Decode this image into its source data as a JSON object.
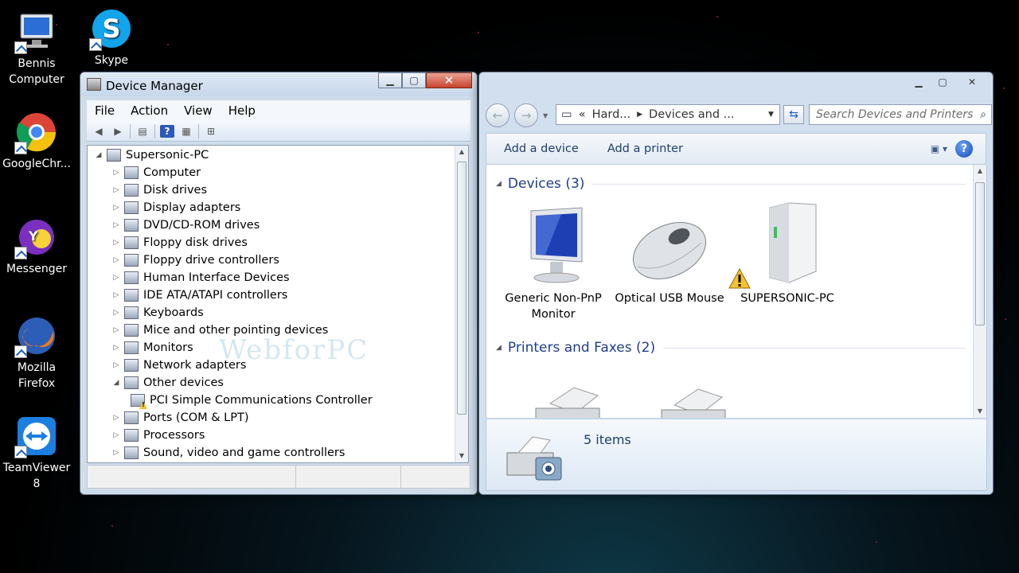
{
  "desktop": {
    "icons": [
      {
        "label": "Bennis Computer",
        "icon": "computer-icon"
      },
      {
        "label": "Skype",
        "icon": "skype-icon"
      },
      {
        "label": "GoogleChr...",
        "icon": "chrome-icon"
      },
      {
        "label": "Messenger",
        "icon": "yahoo-messenger-icon"
      },
      {
        "label": "Mozilla Firefox",
        "icon": "firefox-icon"
      },
      {
        "label": "TeamViewer 8",
        "icon": "teamviewer-icon"
      }
    ],
    "watermark": "WebforPC"
  },
  "device_manager": {
    "title": "Device Manager",
    "menu": [
      "File",
      "Action",
      "View",
      "Help"
    ],
    "tree": {
      "root": "Supersonic-PC",
      "nodes": [
        "Computer",
        "Disk drives",
        "Display adapters",
        "DVD/CD-ROM drives",
        "Floppy disk drives",
        "Floppy drive controllers",
        "Human Interface Devices",
        "IDE ATA/ATAPI controllers",
        "Keyboards",
        "Mice and other pointing devices",
        "Monitors",
        "Network adapters",
        "Other devices"
      ],
      "child_of_other": "PCI Simple Communications Controller",
      "after": [
        "Ports (COM & LPT)",
        "Processors",
        "Sound, video and game controllers"
      ]
    }
  },
  "devices_printers": {
    "breadcrumb": [
      "«",
      "Hard...",
      "Devices and ..."
    ],
    "search_placeholder": "Search Devices and Printers",
    "commands": [
      "Add a device",
      "Add a printer"
    ],
    "devices_group": "Devices (3)",
    "devices": [
      {
        "label": "Generic Non-PnP Monitor",
        "icon": "monitor-icon"
      },
      {
        "label": "Optical USB Mouse",
        "icon": "mouse-icon"
      },
      {
        "label": "SUPERSONIC-PC",
        "icon": "pc-tower-icon",
        "warning": true
      }
    ],
    "printers_group": "Printers and Faxes (2)",
    "status_count": "5 items"
  },
  "colors": {
    "accent": "#1e3d8c",
    "close_button": "#c7442d",
    "warning": "#f3c233"
  }
}
